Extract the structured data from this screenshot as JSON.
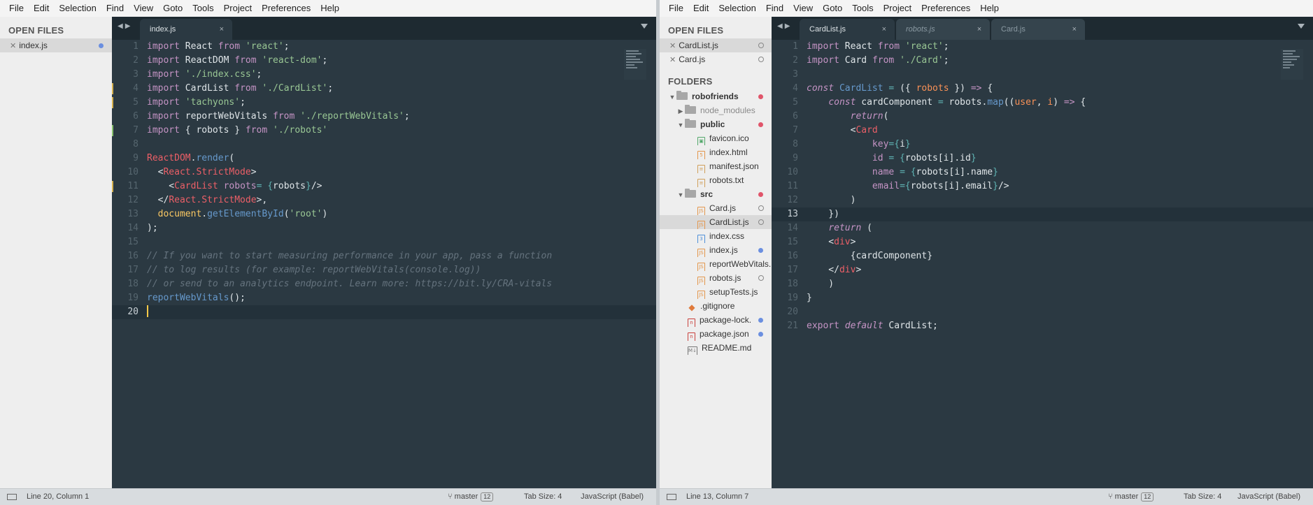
{
  "menu": [
    "File",
    "Edit",
    "Selection",
    "Find",
    "View",
    "Goto",
    "Tools",
    "Project",
    "Preferences",
    "Help"
  ],
  "left": {
    "sidebar": {
      "open_files_heading": "OPEN FILES",
      "open_files": [
        {
          "name": "index.js"
        }
      ]
    },
    "tabs": [
      {
        "label": "index.js",
        "close": "×"
      }
    ],
    "status": {
      "position": "Line 20, Column 1",
      "branch": "master",
      "badge": "12",
      "tab_size": "Tab Size: 4",
      "syntax": "JavaScript (Babel)"
    }
  },
  "right": {
    "sidebar": {
      "open_files_heading": "OPEN FILES",
      "open_files": [
        {
          "name": "CardList.js"
        },
        {
          "name": "Card.js"
        }
      ],
      "folders_heading": "FOLDERS",
      "tree": [
        {
          "name": "robofriends"
        },
        {
          "name": "node_modules"
        },
        {
          "name": "public"
        },
        {
          "name": "favicon.ico"
        },
        {
          "name": "index.html"
        },
        {
          "name": "manifest.json"
        },
        {
          "name": "robots.txt"
        },
        {
          "name": "src"
        },
        {
          "name": "Card.js"
        },
        {
          "name": "CardList.js"
        },
        {
          "name": "index.css"
        },
        {
          "name": "index.js"
        },
        {
          "name": "reportWebVitals."
        },
        {
          "name": "robots.js"
        },
        {
          "name": "setupTests.js"
        },
        {
          "name": ".gitignore"
        },
        {
          "name": "package-lock."
        },
        {
          "name": "package.json"
        },
        {
          "name": "README.md"
        }
      ]
    },
    "tabs": [
      {
        "label": "CardList.js",
        "close": "×"
      },
      {
        "label": "robots.js",
        "close": "×"
      },
      {
        "label": "Card.js",
        "close": "×"
      }
    ],
    "status": {
      "position": "Line 13, Column 7",
      "branch": "master",
      "badge": "12",
      "tab_size": "Tab Size: 4",
      "syntax": "JavaScript (Babel)"
    }
  },
  "code_left": {
    "line_numbers": [
      "1",
      "2",
      "3",
      "4",
      "5",
      "6",
      "7",
      "8",
      "9",
      "10",
      "11",
      "12",
      "13",
      "14",
      "15",
      "16",
      "17",
      "18",
      "19",
      "20"
    ],
    "tokens": {
      "l1": [
        "import",
        " React ",
        "from",
        " ",
        "'react'",
        ";"
      ],
      "l2": [
        "import",
        " ReactDOM ",
        "from",
        " ",
        "'react-dom'",
        ";"
      ],
      "l3": [
        "import",
        " ",
        "'./index.css'",
        ";"
      ],
      "l4": [
        "import",
        " CardList ",
        "from",
        " ",
        "'./CardList'",
        ";"
      ],
      "l5": [
        "import",
        " ",
        "'tachyons'",
        ";"
      ],
      "l6": [
        "import",
        " reportWebVitals ",
        "from",
        " ",
        "'./reportWebVitals'",
        ";"
      ],
      "l7": [
        "import",
        " { robots } ",
        "from",
        " ",
        "'./robots'"
      ],
      "l9": [
        "ReactDOM",
        ".",
        "render",
        "("
      ],
      "l10": [
        "  <",
        "React.StrictMode",
        ">"
      ],
      "l11": [
        "    <",
        "CardList",
        " ",
        "robots",
        "=",
        " {",
        "robots",
        "}",
        "/>"
      ],
      "l12": [
        "  </",
        "React.StrictMode",
        ">",
        ","
      ],
      "l13": [
        "  ",
        "document",
        ".",
        "getElementById",
        "(",
        "'root'",
        ")"
      ],
      "l14": [
        ");"
      ],
      "l16": [
        "// If you want to start measuring performance in your app, pass a function"
      ],
      "l17": [
        "// to log results (for example: reportWebVitals(console.log))"
      ],
      "l18": [
        "// or send to an analytics endpoint. Learn more: https://bit.ly/CRA-vitals"
      ],
      "l19": [
        "reportWebVitals",
        "();"
      ]
    }
  },
  "code_right": {
    "line_numbers": [
      "1",
      "2",
      "3",
      "4",
      "5",
      "6",
      "7",
      "8",
      "9",
      "10",
      "11",
      "12",
      "13",
      "14",
      "15",
      "16",
      "17",
      "18",
      "19",
      "20",
      "21"
    ],
    "tokens": {
      "l1": [
        "import",
        " React ",
        "from",
        " ",
        "'react'",
        ";"
      ],
      "l2": [
        "import",
        " Card ",
        "from",
        " ",
        "'./Card'",
        ";"
      ],
      "l4": [
        "const",
        " ",
        "CardList",
        " ",
        "=",
        " ({ ",
        "robots",
        " }) ",
        "=>",
        " {"
      ],
      "l5": [
        "    ",
        "const",
        " cardComponent ",
        "=",
        " robots.",
        "map",
        "((",
        "user",
        ", ",
        "i",
        ") ",
        "=>",
        " {"
      ],
      "l6": [
        "        ",
        "return",
        "("
      ],
      "l7": [
        "        <",
        "Card"
      ],
      "l8": [
        "            ",
        "key",
        "=",
        "{",
        "i",
        "}"
      ],
      "l9": [
        "            ",
        "id",
        " ",
        "=",
        " {",
        "robots[i].id",
        "}"
      ],
      "l10": [
        "            ",
        "name",
        " ",
        "=",
        " {",
        "robots[i].name",
        "}"
      ],
      "l11": [
        "            ",
        "email",
        "=",
        "{",
        "robots[i].email",
        "}",
        "/>"
      ],
      "l12": [
        "        )"
      ],
      "l13": [
        "    })"
      ],
      "l14": [
        "    ",
        "return",
        " ("
      ],
      "l15": [
        "    <",
        "div",
        ">"
      ],
      "l16": [
        "        {",
        "cardComponent",
        "}"
      ],
      "l17": [
        "    </",
        "div",
        ">"
      ],
      "l18": [
        "    )"
      ],
      "l19": [
        "}"
      ],
      "l21": [
        "export",
        " ",
        "default",
        " CardList;"
      ]
    }
  },
  "colors": {
    "editor_bg": "#2b3942",
    "keyword": "#c594c5",
    "string": "#99c794",
    "tag": "#ec5f67",
    "function": "#6699cc",
    "comment": "#65737e",
    "param": "#f99157",
    "caret": "#f7c948"
  }
}
